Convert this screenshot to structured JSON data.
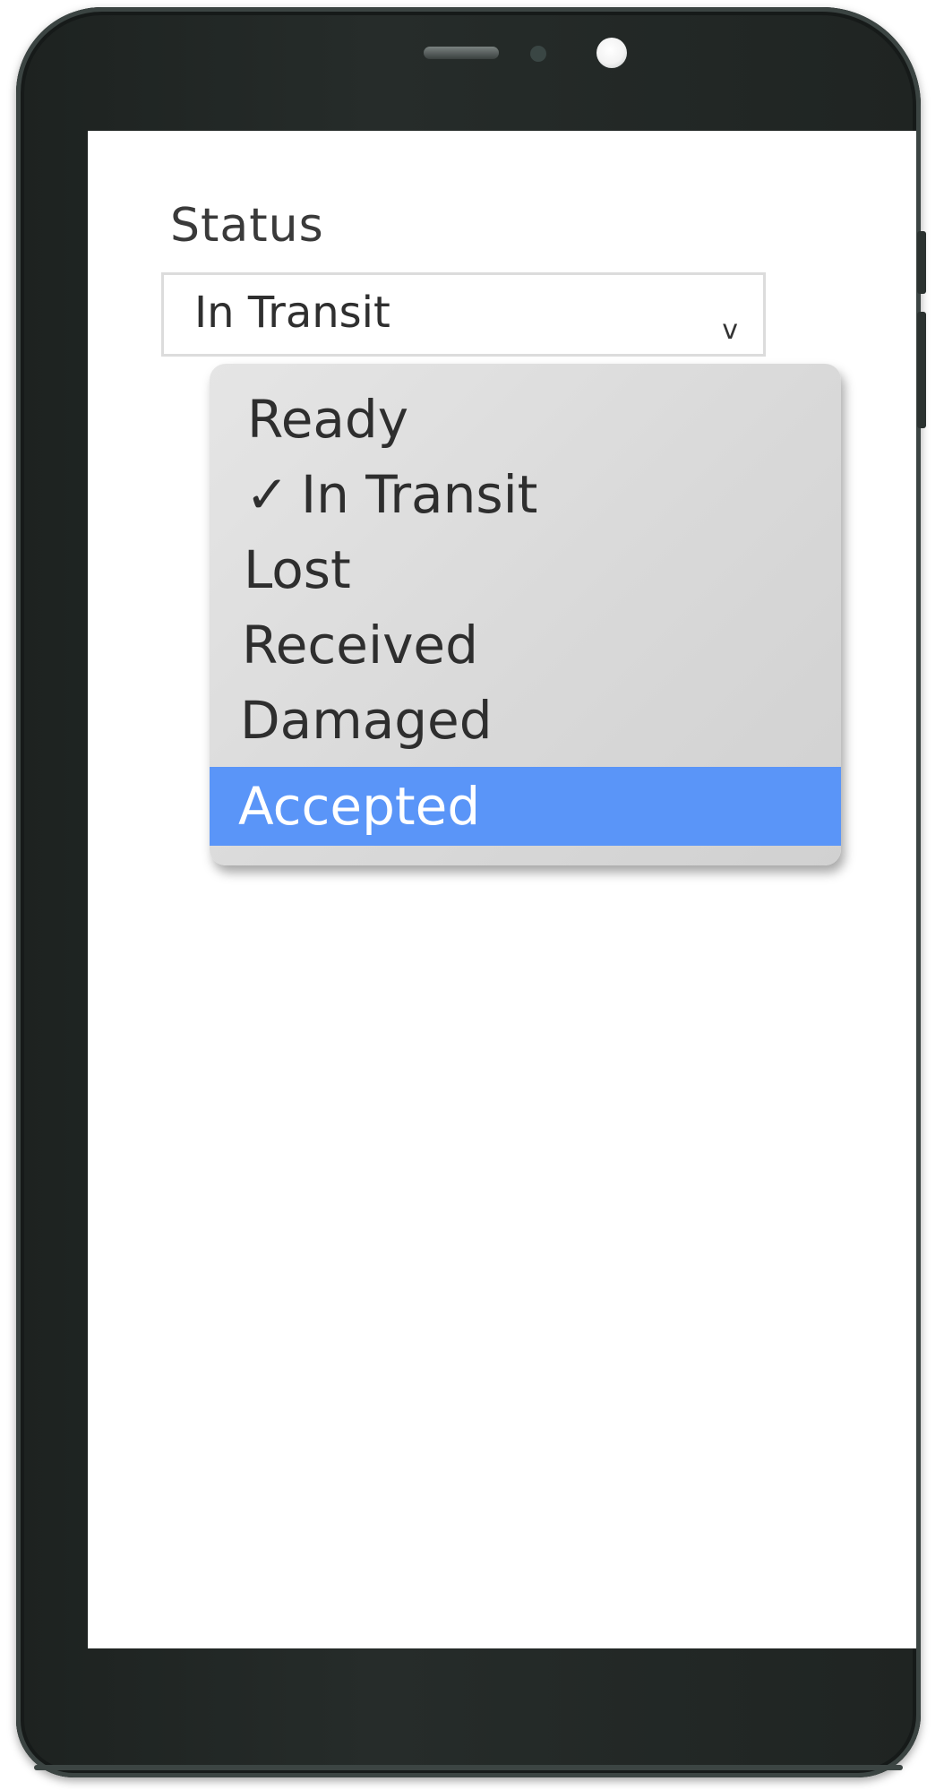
{
  "form": {
    "status_label": "Status",
    "status_value": "In Transit"
  },
  "dropdown": {
    "options": [
      {
        "label": "Ready",
        "checked": false,
        "highlighted": false
      },
      {
        "label": "In Transit",
        "checked": true,
        "highlighted": false
      },
      {
        "label": "Lost",
        "checked": false,
        "highlighted": false
      },
      {
        "label": "Received",
        "checked": false,
        "highlighted": false
      },
      {
        "label": "Damaged",
        "checked": false,
        "highlighted": false
      },
      {
        "label": "Accepted",
        "checked": false,
        "highlighted": true
      }
    ],
    "check_glyph": "✓",
    "chevron_glyph": "v"
  },
  "colors": {
    "highlight": "#5a95f8",
    "menu_background": "#d9d9d9",
    "phone_body": "#1f2422"
  }
}
